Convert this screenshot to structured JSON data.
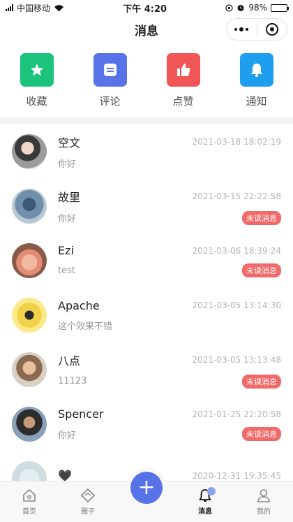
{
  "status": {
    "carrier": "中国移动",
    "time": "下午 4:20",
    "battery": "98%",
    "icons": [
      "signal-icon",
      "wifi-icon",
      "location-icon",
      "alarm-icon",
      "battery-icon"
    ]
  },
  "nav": {
    "title": "消息"
  },
  "quick_actions": [
    {
      "label": "收藏",
      "icon": "star-icon",
      "color": "#1cc37a"
    },
    {
      "label": "评论",
      "icon": "comment-icon",
      "color": "#5872e8"
    },
    {
      "label": "点赞",
      "icon": "thumbs-up-icon",
      "color": "#f15656"
    },
    {
      "label": "通知",
      "icon": "bell-icon",
      "color": "#1e9eef"
    }
  ],
  "messages": [
    {
      "name": "空文",
      "time": "2021-03-18 18:02:19",
      "preview": "你好",
      "badge": ""
    },
    {
      "name": "故里",
      "time": "2021-03-15 22:22:58",
      "preview": "你好",
      "badge": "未读消息"
    },
    {
      "name": "Ezi",
      "time": "2021-03-06 18:39:24",
      "preview": "test",
      "badge": "未读消息"
    },
    {
      "name": "Apache",
      "time": "2021-03-05 13:14:30",
      "preview": "这个效果不错",
      "badge": ""
    },
    {
      "name": "八点",
      "time": "2021-03-05 13:13:48",
      "preview": "11123",
      "badge": "未读消息"
    },
    {
      "name": "Spencer",
      "time": "2021-01-25 22:20:58",
      "preview": "你好",
      "badge": "未读消息"
    },
    {
      "name": "🖤",
      "time": "2020-12-31 19:35:45",
      "preview": "",
      "badge": ""
    }
  ],
  "tabs": [
    {
      "label": "首页",
      "icon": "home-icon"
    },
    {
      "label": "圈子",
      "icon": "circle-icon"
    },
    {
      "label": "",
      "icon": "plus-icon"
    },
    {
      "label": "消息",
      "icon": "bell-icon"
    },
    {
      "label": "我的",
      "icon": "profile-icon"
    }
  ]
}
